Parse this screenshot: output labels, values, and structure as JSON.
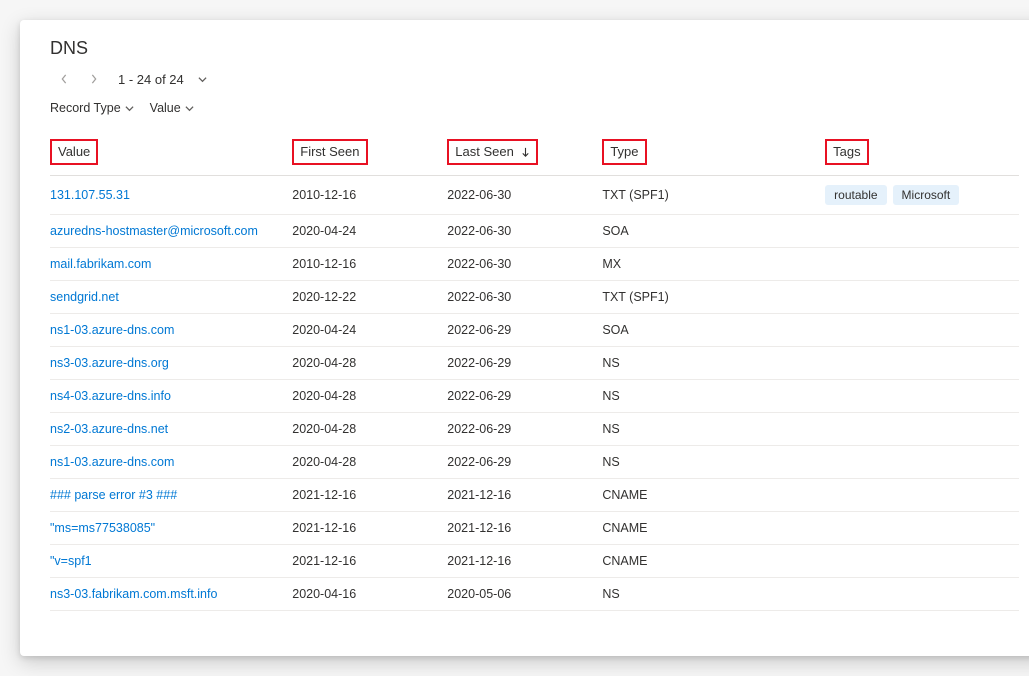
{
  "page": {
    "title": "DNS",
    "pagination": "1 - 24 of 24"
  },
  "filters": {
    "recordType": "Record Type",
    "value": "Value"
  },
  "columns": {
    "value": "Value",
    "firstSeen": "First Seen",
    "lastSeen": "Last Seen",
    "type": "Type",
    "tags": "Tags"
  },
  "rows": [
    {
      "value": "131.107.55.31",
      "firstSeen": "2010-12-16",
      "lastSeen": "2022-06-30",
      "type": "TXT (SPF1)",
      "tags": [
        "routable",
        "Microsoft"
      ]
    },
    {
      "value": "azuredns-hostmaster@microsoft.com",
      "firstSeen": "2020-04-24",
      "lastSeen": "2022-06-30",
      "type": "SOA",
      "tags": []
    },
    {
      "value": "mail.fabrikam.com",
      "firstSeen": "2010-12-16",
      "lastSeen": "2022-06-30",
      "type": "MX",
      "tags": []
    },
    {
      "value": "sendgrid.net",
      "firstSeen": "2020-12-22",
      "lastSeen": "2022-06-30",
      "type": "TXT (SPF1)",
      "tags": []
    },
    {
      "value": "ns1-03.azure-dns.com",
      "firstSeen": "2020-04-24",
      "lastSeen": "2022-06-29",
      "type": "SOA",
      "tags": []
    },
    {
      "value": "ns3-03.azure-dns.org",
      "firstSeen": "2020-04-28",
      "lastSeen": "2022-06-29",
      "type": "NS",
      "tags": []
    },
    {
      "value": "ns4-03.azure-dns.info",
      "firstSeen": "2020-04-28",
      "lastSeen": "2022-06-29",
      "type": "NS",
      "tags": []
    },
    {
      "value": "ns2-03.azure-dns.net",
      "firstSeen": "2020-04-28",
      "lastSeen": "2022-06-29",
      "type": "NS",
      "tags": []
    },
    {
      "value": "ns1-03.azure-dns.com",
      "firstSeen": "2020-04-28",
      "lastSeen": "2022-06-29",
      "type": "NS",
      "tags": []
    },
    {
      "value": "### parse error #3 ###",
      "firstSeen": "2021-12-16",
      "lastSeen": "2021-12-16",
      "type": "CNAME",
      "tags": []
    },
    {
      "value": "\"ms=ms77538085\"",
      "firstSeen": "2021-12-16",
      "lastSeen": "2021-12-16",
      "type": "CNAME",
      "tags": []
    },
    {
      "value": "\"v=spf1",
      "firstSeen": "2021-12-16",
      "lastSeen": "2021-12-16",
      "type": "CNAME",
      "tags": []
    },
    {
      "value": "ns3-03.fabrikam.com.msft.info",
      "firstSeen": "2020-04-16",
      "lastSeen": "2020-05-06",
      "type": "NS",
      "tags": []
    }
  ]
}
